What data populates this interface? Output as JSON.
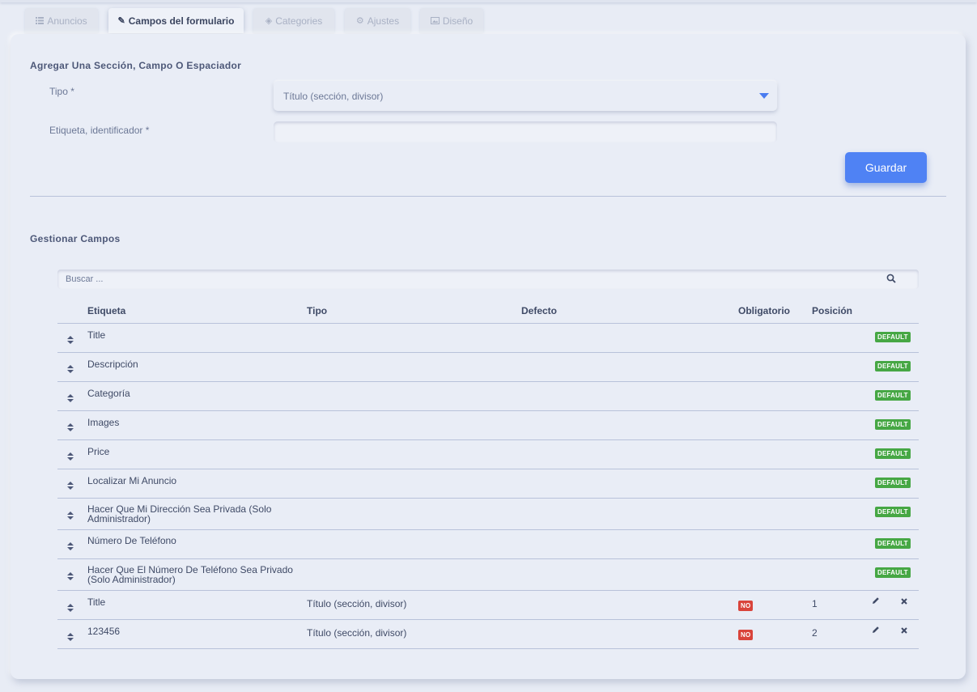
{
  "tabs": [
    {
      "label": "Anuncios",
      "icon": "list-icon",
      "active": false
    },
    {
      "label": "Campos del formulario",
      "icon": "paperclip-icon",
      "active": true
    },
    {
      "label": "Categories",
      "icon": "tags-icon",
      "active": false
    },
    {
      "label": "Ajustes",
      "icon": "gears-icon",
      "active": false
    },
    {
      "label": "Diseño",
      "icon": "image-icon",
      "active": false
    }
  ],
  "add_section": {
    "title": "Agregar Una Sección, Campo O Espaciador",
    "type_label": "Tipo *",
    "type_value": "Título (sección, divisor)",
    "label_label": "Etiqueta, identificador *",
    "label_value": "",
    "save_label": "Guardar"
  },
  "manage": {
    "title": "Gestionar Campos",
    "search_placeholder": "Buscar ...",
    "columns": {
      "label": "Etiqueta",
      "type": "Tipo",
      "default": "Defecto",
      "required": "Obligatorio",
      "position": "Posición"
    },
    "rows": [
      {
        "label": "Title",
        "default_badge": "DEFAULT"
      },
      {
        "label": "Descripción",
        "default_badge": "DEFAULT"
      },
      {
        "label": "Categoría",
        "default_badge": "DEFAULT"
      },
      {
        "label": "Images",
        "default_badge": "DEFAULT"
      },
      {
        "label": "Price",
        "default_badge": "DEFAULT"
      },
      {
        "label": "Localizar Mi Anuncio",
        "default_badge": "DEFAULT"
      },
      {
        "label": "Hacer Que Mi Dirección Sea Privada (Solo Administrador)",
        "default_badge": "DEFAULT"
      },
      {
        "label": "Número De Teléfono",
        "default_badge": "DEFAULT"
      },
      {
        "label": "Hacer Que El Número De Teléfono Sea Privado (Solo Administrador)",
        "default_badge": "DEFAULT"
      },
      {
        "label": "Title",
        "type": "Título (sección, divisor)",
        "required": "NO",
        "position": "1"
      },
      {
        "label": "123456",
        "type": "Título (sección, divisor)",
        "required": "NO",
        "position": "2"
      }
    ]
  },
  "colors": {
    "accent": "#4f82f4",
    "default_badge": "#46a744",
    "no_badge": "#d9443b",
    "background": "#e8ecf5"
  }
}
